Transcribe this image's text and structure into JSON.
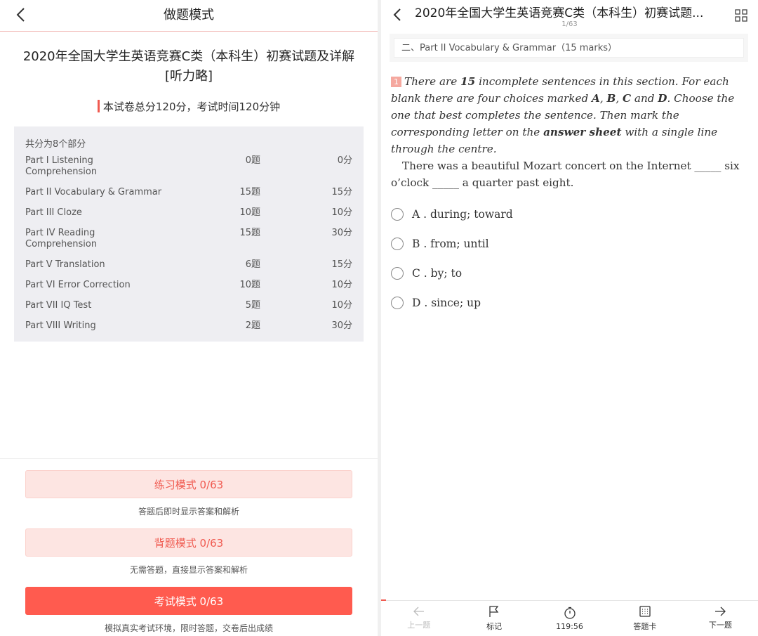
{
  "left": {
    "header_title": "做题模式",
    "exam_title": "2020年全国大学生英语竞赛C类（本科生）初赛试题及详解[听力略]",
    "summary": "本试卷总分120分，考试时间120分钟",
    "parts_heading": "共分为8个部分",
    "parts": [
      {
        "name": "Part I   Listening Comprehension",
        "count": "0题",
        "score": "0分"
      },
      {
        "name": "Part II   Vocabulary & Grammar",
        "count": "15题",
        "score": "15分"
      },
      {
        "name": "Part III   Cloze",
        "count": "10题",
        "score": "10分"
      },
      {
        "name": "Part IV   Reading Comprehension",
        "count": "15题",
        "score": "30分"
      },
      {
        "name": "Part V   Translation",
        "count": "6题",
        "score": "15分"
      },
      {
        "name": "Part VI   Error Correction",
        "count": "10题",
        "score": "10分"
      },
      {
        "name": "Part VII   IQ Test",
        "count": "5题",
        "score": "10分"
      },
      {
        "name": "Part VIII   Writing",
        "count": "2题",
        "score": "30分"
      }
    ],
    "modes": [
      {
        "label": "练习模式  0/63",
        "desc": "答题后即时显示答案和解析"
      },
      {
        "label": "背题模式  0/63",
        "desc": "无需答题，直接显示答案和解析"
      },
      {
        "label": "考试模式  0/63",
        "desc": "模拟真实考试环境，限时答题，交卷后出成绩"
      }
    ]
  },
  "right": {
    "header_title": "2020年全国大学生英语竞赛C类（本科生）初赛试题...",
    "progress": "1/63",
    "section": "二、Part II   Vocabulary & Grammar（15 marks）",
    "question_number": "1",
    "instr_1": "There are ",
    "instr_b1": "15",
    "instr_2": " incomplete sentences in this section. For each blank there are four choices marked ",
    "instr_b2": "A",
    "instr_3": ", ",
    "instr_b3": "B",
    "instr_4": ", ",
    "instr_b4": "C",
    "instr_5": " and ",
    "instr_b5": "D",
    "instr_6": ". Choose the one that best completes the sentence. Then mark the corresponding letter on the ",
    "instr_b6": "answer sheet",
    "instr_7": " with a single line through the centre.",
    "stem": "There was a beautiful Mozart concert on the Internet _____ six o’clock _____ a quarter past eight.",
    "options": [
      {
        "text": "A .  during; toward"
      },
      {
        "text": "B .  from; until"
      },
      {
        "text": "C .  by; to"
      },
      {
        "text": "D .  since; up"
      }
    ],
    "footer": {
      "prev": "上一题",
      "mark": "标记",
      "timer": "119:56",
      "answer_card": "答题卡",
      "next": "下一题"
    }
  }
}
